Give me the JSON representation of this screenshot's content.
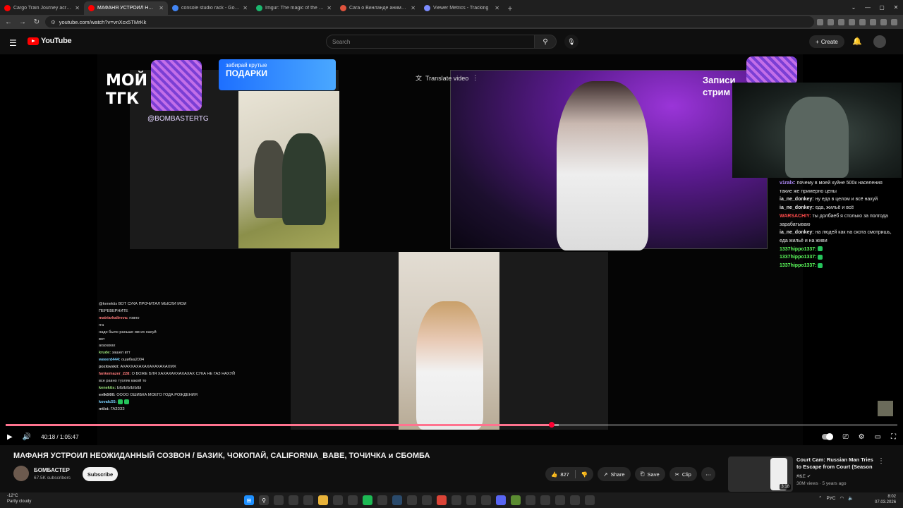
{
  "browser": {
    "tabs": [
      {
        "title": "Cargo Train Journey across Amer...",
        "favicon_color": "#ff0000",
        "active": false
      },
      {
        "title": "МАФАНЯ УСТРОИЛ НЕОЖИДАН...",
        "favicon_color": "#ff0000",
        "active": true
      },
      {
        "title": "console studio rack - Google S...",
        "favicon_color": "#4285f4",
        "active": false
      },
      {
        "title": "Imgur: The magic of the Intern...",
        "favicon_color": "#1bb76e",
        "active": false
      },
      {
        "title": "Сага о Винланде аниме 2019 ...",
        "favicon_color": "#e0533d",
        "active": false
      },
      {
        "title": "Viewer Metrics - Tracking",
        "favicon_color": "#7c8cff",
        "active": false
      }
    ],
    "url": "youtube.com/watch?v=vnXcx5TMrKk"
  },
  "youtube": {
    "logo_text": "YouTube",
    "search_placeholder": "Search",
    "create_label": "Create"
  },
  "video": {
    "overlay": {
      "tg_label_line1": "МОЙ",
      "tg_label_line2": "ТГК",
      "tg_handle": "@BOMBASTERTG",
      "banner_line1": "забирай крутые",
      "banner_line2": "ПОДАРКИ",
      "translate_label": "Translate video",
      "zapisi_line1": "Записи",
      "zapisi_line2": "стрим"
    },
    "chat_right": [
      {
        "user": "v1ralx:",
        "color": "#b28cff",
        "text": "почему в моей хуйне 500к населения такие же примерно цены"
      },
      {
        "user": "ia_ne_donkey:",
        "color": "#e8e8e8",
        "text": "ну еда в целом и всё нахуй"
      },
      {
        "user": "ia_ne_donkey:",
        "color": "#e8e8e8",
        "text": "еда, жильё и всё"
      },
      {
        "user": "WARSACHIY:",
        "color": "#ff4b4b",
        "text": "ты долбаеб я столько за полгода зарабатываю"
      },
      {
        "user": "ia_ne_donkey:",
        "color": "#e8e8e8",
        "text": "на людей как на скота смотришь, еда жильё и на живи"
      },
      {
        "user": "1337hippo1337:",
        "color": "#5dff5d",
        "text": ""
      },
      {
        "user": "1337hippo1337:",
        "color": "#5dff5d",
        "text": ""
      },
      {
        "user": "1337hippo1337:",
        "color": "#5dff5d",
        "text": ""
      }
    ],
    "chat_left": [
      {
        "user": "",
        "color": "#e04b7a",
        "text": "@kenektis ВОТ СУКА ПРОЧИТАЛ МЫСЛИ МОИ"
      },
      {
        "user": "",
        "color": "#8f7cff",
        "text": "ПЕРЕВЕРНИТЕ"
      },
      {
        "user": "matriarkalireva:",
        "color": "#ff7b7b",
        "text": "говно"
      },
      {
        "user": "",
        "color": "#7b9bff",
        "text": "гга"
      },
      {
        "user": "",
        "color": "#8f7cff",
        "text": "надо было раньше им их нахуй"
      },
      {
        "user": "",
        "color": "#c98cff",
        "text": "вот"
      },
      {
        "user": "",
        "color": "#7bd2ff",
        "text": "ахахахах"
      },
      {
        "user": "krude:",
        "color": "#9be37b",
        "text": "зашел втт"
      },
      {
        "user": "weeerd444:",
        "color": "#7bd2ff",
        "text": "ошибка2004"
      },
      {
        "user": "pozlovskii:",
        "color": "#d0d0d0",
        "text": "АХАХХАХАХАХАХАХАХАХМХ"
      },
      {
        "user": "fankemazer_228:",
        "color": "#ff7b7b",
        "text": "О БОЖЕ БЛЯ ХАХАХАХХАХАХАХ СУКА НЕ ГАЗ НАХУЙ"
      },
      {
        "user": "",
        "color": "#e04b7a",
        "text": "все равно тухляк какой то"
      },
      {
        "user": "kenektis:",
        "color": "#9be37b",
        "text": "ЫЫЫЫЫЫЫ"
      },
      {
        "user": "evlk6l00:",
        "color": "#d0d0d0",
        "text": "ОООО ОШИБКА МОЕГО ГОДА РОЖДЕНИЯ"
      },
      {
        "user": "kovalc55:",
        "color": "#7bd2ff",
        "text": ""
      },
      {
        "user": "mtlst:",
        "color": "#d0d0d0",
        "text": "ГАЗЗЗЗ"
      }
    ]
  },
  "controls": {
    "time": "40:18 / 1:05:47",
    "progress_fraction": 0.6126
  },
  "details": {
    "title": "МАФАНЯ УСТРОИЛ НЕОЖИДАННЫЙ СОЗВОН / БАЗИК, ЧОКОПАЙ, CALIFORNIA_BABE, ТОЧИЧКА и СБОМБА",
    "channel_name": "БОМБАСТЕР",
    "subscribers": "67.5K subscribers",
    "subscribe_label": "Subscribe",
    "likes": "827",
    "share_label": "Share",
    "save_label": "Save",
    "clip_label": "Clip"
  },
  "recommendation": {
    "title": "Court Cam: Russian Man Tries to Escape from Court (Season ...",
    "channel": "A&E",
    "meta": "30M views · 5 years ago",
    "duration": "3:18"
  },
  "taskbar": {
    "temp": "-12°C",
    "weather": "Partly cloudy",
    "lang": "РУС",
    "time": "8:02",
    "date": "07.03.2026"
  }
}
